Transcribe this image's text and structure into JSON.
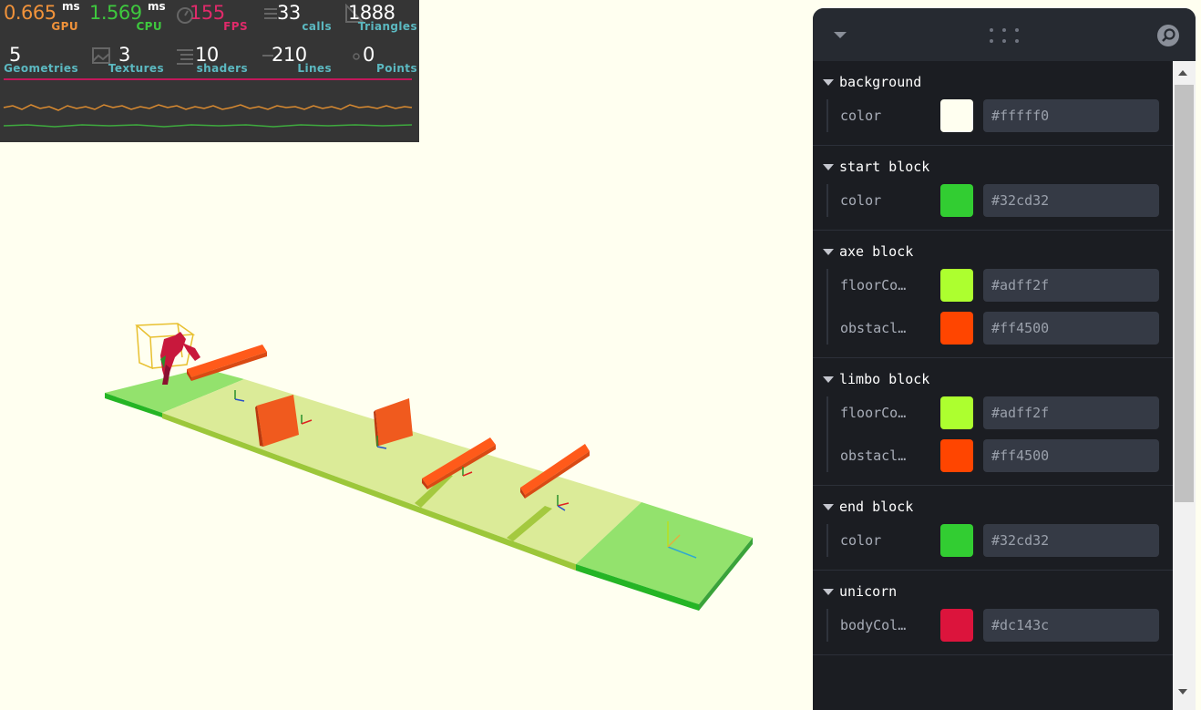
{
  "stats": {
    "gpu": {
      "value": "0.665",
      "unit": "ms",
      "label": "GPU",
      "color": "#f0923a"
    },
    "cpu": {
      "value": "1.569",
      "unit": "ms",
      "label": "CPU",
      "color": "#3ec83e"
    },
    "fps": {
      "value": "155",
      "label": "FPS",
      "color": "#e02a6a"
    },
    "calls": {
      "value": "33",
      "label": "calls",
      "color": "#5bb8c0"
    },
    "triangles": {
      "value": "1888",
      "label": "Triangles",
      "color": "#5bb8c0"
    },
    "geometries": {
      "value": "5",
      "label": "Geometries",
      "color": "#5bb8c0"
    },
    "textures": {
      "value": "3",
      "label": "Textures",
      "color": "#5bb8c0"
    },
    "shaders": {
      "value": "10",
      "label": "shaders",
      "color": "#5bb8c0"
    },
    "lines": {
      "value": "210",
      "label": "Lines",
      "color": "#5bb8c0"
    },
    "points": {
      "value": "0",
      "label": "Points",
      "color": "#5bb8c0"
    }
  },
  "gui": {
    "header_icons": [
      "collapse-chevron-icon",
      "drag-handle-icon",
      "search-icon"
    ],
    "folders": [
      {
        "title": "background",
        "rows": [
          {
            "label": "color",
            "color": "#fffff0",
            "hex": "#fffff0"
          }
        ]
      },
      {
        "title": "start block",
        "rows": [
          {
            "label": "color",
            "color": "#32cd32",
            "hex": "#32cd32"
          }
        ]
      },
      {
        "title": "axe block",
        "rows": [
          {
            "label": "floorCo…",
            "color": "#adff2f",
            "hex": "#adff2f"
          },
          {
            "label": "obstacl…",
            "color": "#ff4500",
            "hex": "#ff4500"
          }
        ]
      },
      {
        "title": "limbo block",
        "rows": [
          {
            "label": "floorCo…",
            "color": "#adff2f",
            "hex": "#adff2f"
          },
          {
            "label": "obstacl…",
            "color": "#ff4500",
            "hex": "#ff4500"
          }
        ]
      },
      {
        "title": "end block",
        "rows": [
          {
            "label": "color",
            "color": "#32cd32",
            "hex": "#32cd32"
          }
        ]
      },
      {
        "title": "unicorn",
        "rows": [
          {
            "label": "bodyCol…",
            "color": "#dc143c",
            "hex": "#dc143c"
          }
        ]
      }
    ]
  }
}
